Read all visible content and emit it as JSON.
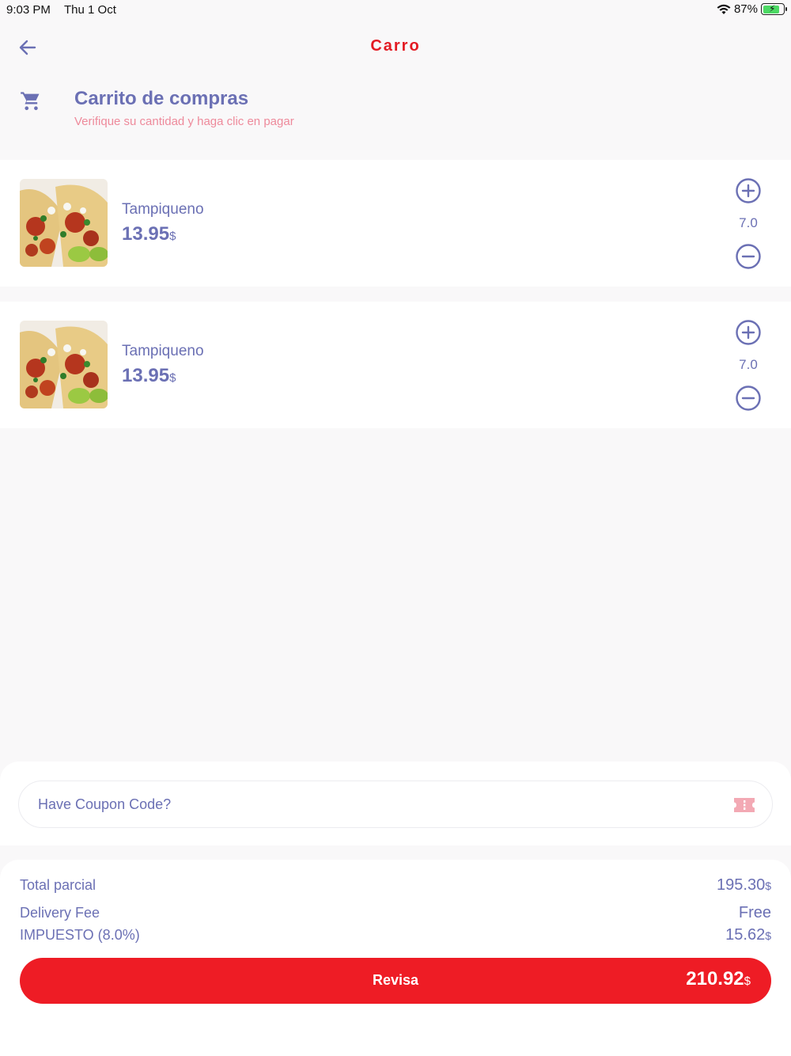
{
  "status_bar": {
    "time": "9:03 PM",
    "date": "Thu 1 Oct",
    "battery": "87%",
    "icons": [
      "wifi-icon",
      "battery-charging-icon"
    ]
  },
  "header": {
    "title": "Carro",
    "back_icon": "arrow-left-icon"
  },
  "cart": {
    "icon": "shopping-cart-icon",
    "title": "Carrito de compras",
    "subtitle": "Verifique su cantidad y haga clic en pagar"
  },
  "items": [
    {
      "name": "Tampiqueno",
      "price": "13.95",
      "currency": "$",
      "quantity": "7.0"
    },
    {
      "name": "Tampiqueno",
      "price": "13.95",
      "currency": "$",
      "quantity": "7.0"
    }
  ],
  "coupon": {
    "placeholder": "Have Coupon Code?",
    "icon": "ticket-icon"
  },
  "totals": {
    "subtotal_label": "Total parcial",
    "subtotal_value": "195.30",
    "delivery_label": "Delivery Fee",
    "delivery_value": "Free",
    "tax_label": "IMPUESTO (8.0%)",
    "tax_value": "15.62",
    "currency": "$"
  },
  "checkout": {
    "label": "Revisa",
    "total": "210.92",
    "currency": "$"
  },
  "colors": {
    "accent_red": "#e31b23",
    "button_red": "#ee1c25",
    "text_purple": "#6b70b4",
    "subtitle_pink": "#ee8a9b",
    "background": "#f9f8f9"
  }
}
